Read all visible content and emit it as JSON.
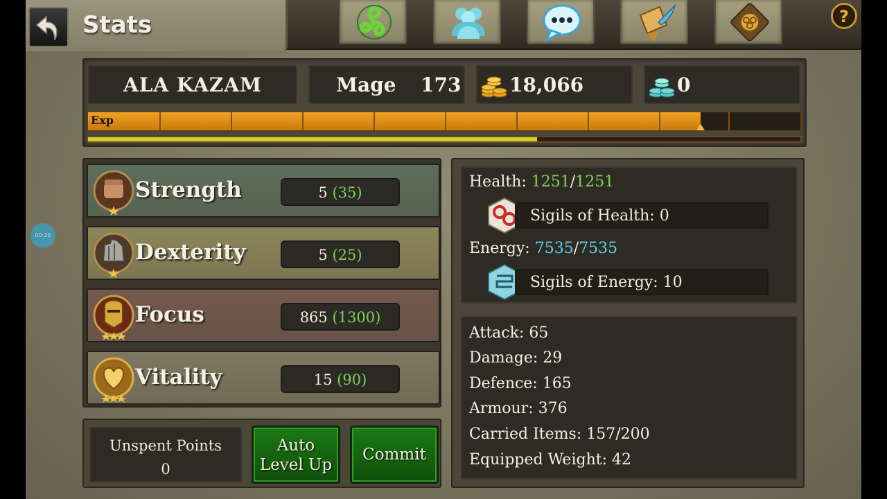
{
  "page": {
    "title": "Stats"
  },
  "nav": {
    "items": [
      {
        "icon": "triskele-icon"
      },
      {
        "icon": "party-icon"
      },
      {
        "icon": "chat-icon"
      },
      {
        "icon": "quest-scroll-icon"
      },
      {
        "icon": "guild-crest-icon"
      }
    ],
    "help": "?"
  },
  "player": {
    "name": "ALA KAZAM",
    "class": "Mage",
    "level": "173",
    "gold": "18,066",
    "gems": "0"
  },
  "exp": {
    "label": "Exp",
    "progress": 0.86,
    "secondary_progress": 0.63
  },
  "attributes": [
    {
      "name": "Strength",
      "base": "5",
      "total": "(35)",
      "icon": "strength-fist-icon",
      "tint": "#5d6e5a"
    },
    {
      "name": "Dexterity",
      "base": "5",
      "total": "(25)",
      "icon": "dexterity-gauntlet-icon",
      "tint": "#8d855a"
    },
    {
      "name": "Focus",
      "base": "865",
      "total": "(1300)",
      "icon": "focus-helm-icon",
      "tint": "#74594d"
    },
    {
      "name": "Vitality",
      "base": "15",
      "total": "(90)",
      "icon": "vitality-heart-icon",
      "tint": "#7e7860"
    }
  ],
  "points": {
    "unspent_label": "Unspent Points",
    "unspent_value": "0",
    "auto_label_1": "Auto",
    "auto_label_2": "Level Up",
    "commit_label": "Commit"
  },
  "vitals": {
    "health_label": "Health:",
    "health_current": "1251",
    "health_sep": "/",
    "health_max": "1251",
    "sigils_health": "Sigils of Health: 0",
    "energy_label": "Energy:",
    "energy_current": "7535",
    "energy_sep": "/",
    "energy_max": "7535",
    "sigils_energy": "Sigils of Energy: 10"
  },
  "stats": [
    "Attack: 65",
    "Damage: 29",
    "Defence: 165",
    "Armour: 376",
    "Carried Items: 157/200",
    "Equipped Weight: 42"
  ],
  "overlay": {
    "timer": "00:20"
  },
  "colors": {
    "accent_green": "#7fd35a",
    "energy_blue": "#5fd0e8",
    "exp_orange": "#f1a224",
    "button_green": "#1d7a14"
  }
}
